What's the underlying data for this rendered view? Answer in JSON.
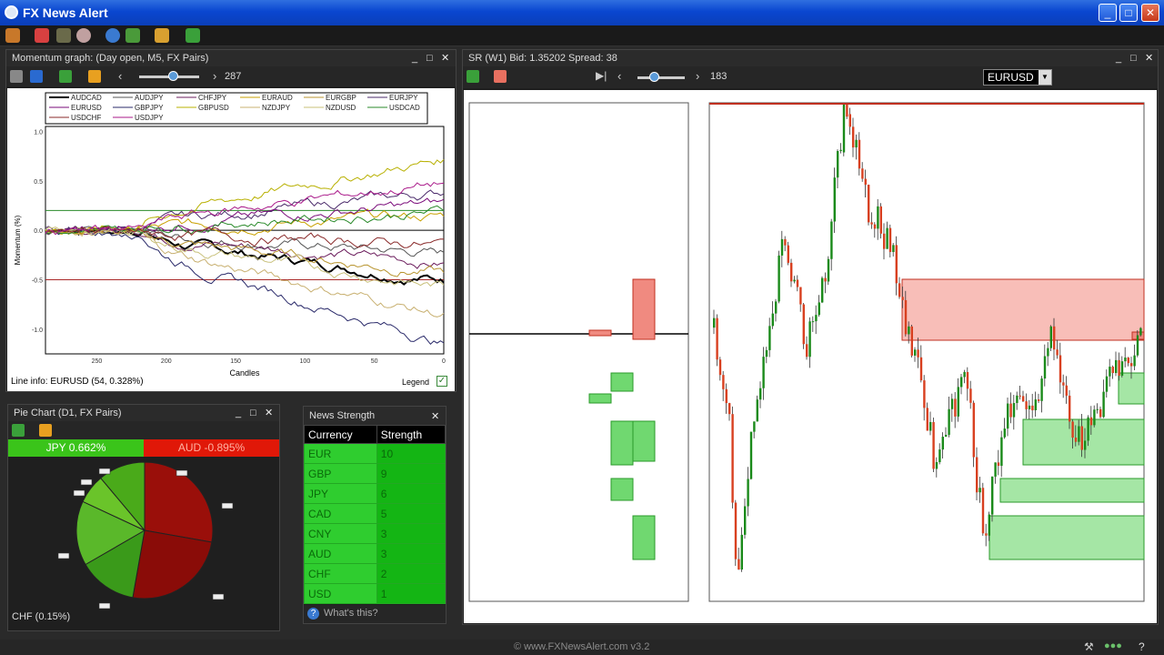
{
  "window": {
    "title": "FX News Alert",
    "minimize": "_",
    "maximize": "□",
    "close": "✕"
  },
  "toolbar": {
    "icons": [
      "wand-icon",
      "megaphone-icon",
      "chart-icon",
      "eye-icon",
      "ie-icon",
      "tree-icon",
      "folder-icon",
      "link-icon"
    ]
  },
  "momentum": {
    "title": "Momentum graph: (Day open, M5, FX Pairs)",
    "slider_value": "287",
    "legend": [
      {
        "name": "AUDCAD",
        "color": "#000000",
        "width": 2
      },
      {
        "name": "AUDJPY",
        "color": "#555555",
        "width": 1
      },
      {
        "name": "CHFJPY",
        "color": "#6b1c5c",
        "width": 1
      },
      {
        "name": "EURAUD",
        "color": "#c8a000",
        "width": 1
      },
      {
        "name": "EURGBP",
        "color": "#b89530",
        "width": 1
      },
      {
        "name": "EURJPY",
        "color": "#4a2a6a",
        "width": 1
      },
      {
        "name": "EURUSD",
        "color": "#7a0a7a",
        "width": 1
      },
      {
        "name": "GBPJPY",
        "color": "#2a2a6a",
        "width": 1
      },
      {
        "name": "GBPUSD",
        "color": "#b8b000",
        "width": 1
      },
      {
        "name": "NZDJPY",
        "color": "#c8b070",
        "width": 1
      },
      {
        "name": "NZDUSD",
        "color": "#c8c07a",
        "width": 1
      },
      {
        "name": "USDCAD",
        "color": "#2a8a2a",
        "width": 1
      },
      {
        "name": "USDCHF",
        "color": "#8a2a2a",
        "width": 1
      },
      {
        "name": "USDJPY",
        "color": "#aa1a8a",
        "width": 1
      }
    ],
    "y_axis_label": "Momentum (%)",
    "y_ticks": [
      "1.0",
      "0.5",
      "0.0",
      "-0.5",
      "-1.0"
    ],
    "x_axis_label": "Candles",
    "x_ticks": [
      "250",
      "200",
      "150",
      "100",
      "50",
      "0"
    ],
    "line_info": "Line info: EURUSD (54, 0.328%)",
    "legend_toggle_label": "Legend",
    "legend_checked": "✓"
  },
  "chart_data": [
    {
      "type": "line",
      "title": "Momentum graph: (Day open, M5, FX Pairs)",
      "xlabel": "Candles",
      "ylabel": "Momentum (%)",
      "ylim": [
        -1.25,
        1.05
      ],
      "xlim": [
        287,
        0
      ],
      "series_names": [
        "AUDCAD",
        "AUDJPY",
        "CHFJPY",
        "EURAUD",
        "EURGBP",
        "EURJPY",
        "EURUSD",
        "GBPJPY",
        "GBPUSD",
        "NZDJPY",
        "NZDUSD",
        "USDCAD",
        "USDCHF",
        "USDJPY"
      ],
      "annotations": {
        "EURUSD_at_candle_54": 0.328
      }
    },
    {
      "type": "pie",
      "title": "Pie Chart (D1, FX Pairs)",
      "labels": [
        "JPY",
        "AUD",
        "CHF"
      ],
      "values": [
        0.662,
        -0.895,
        0.15
      ]
    }
  ],
  "pie": {
    "title": "Pie Chart (D1, FX Pairs)",
    "top_left": "JPY 0.662%",
    "top_right": "AUD -0.895%",
    "top_left_color": "#3ac41a",
    "top_right_color": "#e01808",
    "bottom_label": "CHF (0.15%)",
    "flag_icons": [
      "flag-icon",
      "flag-icon",
      "flag-icon",
      "flag-icon",
      "flag-icon",
      "flag-icon",
      "flag-icon",
      "flag-icon"
    ]
  },
  "news": {
    "title": "News Strength",
    "headers": [
      "Currency",
      "Strength"
    ],
    "rows": [
      [
        "EUR",
        "10"
      ],
      [
        "GBP",
        "9"
      ],
      [
        "JPY",
        "6"
      ],
      [
        "CAD",
        "5"
      ],
      [
        "CNY",
        "3"
      ],
      [
        "AUD",
        "3"
      ],
      [
        "CHF",
        "2"
      ],
      [
        "USD",
        "1"
      ]
    ],
    "footer": "What's this?"
  },
  "sr": {
    "title": "SR (W1) Bid: 1.35202 Spread: 38",
    "symbol": "EURUSD",
    "slider_value": "183",
    "bull_color": "#1a8a1a",
    "bear_color": "#d84020"
  },
  "status": {
    "copyright": "© www.FXNewsAlert.com v3.2"
  }
}
